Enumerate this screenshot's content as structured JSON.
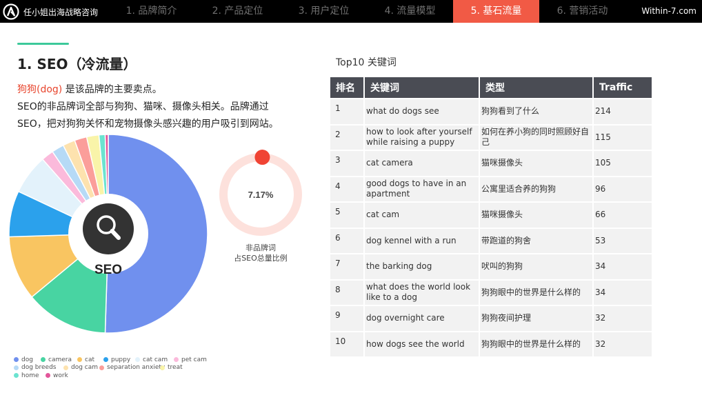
{
  "header": {
    "brand": "任小姐出海战略咨询",
    "site": "Within-7.com",
    "tabs": [
      {
        "label": "1. 品牌简介",
        "active": false
      },
      {
        "label": "2. 产品定位",
        "active": false
      },
      {
        "label": "3. 用户定位",
        "active": false
      },
      {
        "label": "4. 流量模型",
        "active": false
      },
      {
        "label": "5. 基石流量",
        "active": true
      },
      {
        "label": "6. 营销活动",
        "active": false
      }
    ]
  },
  "section": {
    "title": "1. SEO（冷流量）",
    "intro_highlight": "狗狗(dog)",
    "intro_line1_rest": " 是该品牌的主要卖点。",
    "intro_line2": "SEO的非品牌词全部与狗狗、猫咪、摄像头相关。品牌通过",
    "intro_line3": "SEO，把对狗狗关怀和宠物摄像头感兴趣的用户吸引到网站。"
  },
  "chart_data": [
    {
      "type": "pie",
      "center_label": "SEO",
      "center_icon": "search-icon",
      "slices": [
        {
          "name": "dog",
          "value": 50.5,
          "color": "#7090ee"
        },
        {
          "name": "camera",
          "value": 13.5,
          "color": "#48d4a2"
        },
        {
          "name": "cat",
          "value": 10.5,
          "color": "#f9c561"
        },
        {
          "name": "puppy",
          "value": 7.5,
          "color": "#2ba1ec"
        },
        {
          "name": "cat cam",
          "value": 6.5,
          "color": "#e3f2fb"
        },
        {
          "name": "pet cam",
          "value": 2.0,
          "color": "#fbbadb"
        },
        {
          "name": "dog breeds",
          "value": 2.0,
          "color": "#b6daf6"
        },
        {
          "name": "dog cam",
          "value": 2.0,
          "color": "#fde2ae"
        },
        {
          "name": "separation anxiety",
          "value": 2.0,
          "color": "#fb9e9a"
        },
        {
          "name": "treat",
          "value": 2.0,
          "color": "#f9f4a9"
        },
        {
          "name": "home",
          "value": 1.0,
          "color": "#6be3d0"
        },
        {
          "name": "work",
          "value": 0.5,
          "color": "#e2569a"
        }
      ]
    },
    {
      "type": "gauge",
      "value_label": "7.17%",
      "value": 7.17,
      "track_color": "#fde1dc",
      "indicator_color": "#f04434",
      "caption_line1": "非品牌词",
      "caption_line2": "占SEO总量比例"
    },
    {
      "type": "table",
      "title": "Top10 关键词",
      "columns": [
        "排名",
        "关键词",
        "类型",
        "Traffic"
      ],
      "rows": [
        {
          "rank": "1",
          "keyword": "what do dogs see",
          "type": "狗狗看到了什么",
          "traffic": "214"
        },
        {
          "rank": "2",
          "keyword": "how to look after yourself while raising a puppy",
          "type": "如何在养小狗的同时照顾好自己",
          "traffic": "115"
        },
        {
          "rank": "3",
          "keyword": "cat camera",
          "type": "猫咪摄像头",
          "traffic": "105"
        },
        {
          "rank": "4",
          "keyword": "good dogs to have in an apartment",
          "type": "公寓里适合养的狗狗",
          "traffic": "96"
        },
        {
          "rank": "5",
          "keyword": "cat cam",
          "type": "猫咪摄像头",
          "traffic": "66"
        },
        {
          "rank": "6",
          "keyword": "dog kennel with a run",
          "type": "带跑道的狗舍",
          "traffic": "53"
        },
        {
          "rank": "7",
          "keyword": "the barking dog",
          "type": "吠叫的狗狗",
          "traffic": "34"
        },
        {
          "rank": "8",
          "keyword": "what does the world look like to a dog",
          "type": "狗狗眼中的世界是什么样的",
          "traffic": "34"
        },
        {
          "rank": "9",
          "keyword": "dog overnight care",
          "type": "狗狗夜间护理",
          "traffic": "32"
        },
        {
          "rank": "10",
          "keyword": "how dogs see the world",
          "type": "狗狗眼中的世界是什么样的",
          "traffic": "32"
        }
      ]
    }
  ]
}
